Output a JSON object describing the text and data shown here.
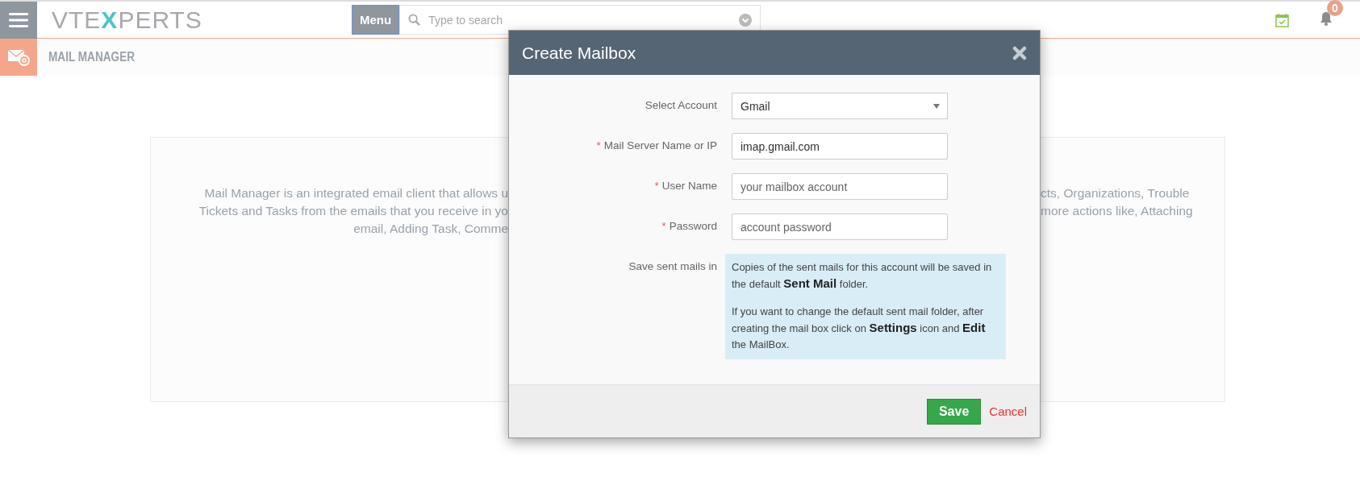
{
  "header": {
    "logo": {
      "before": "VTE",
      "accent": "X",
      "after": "PERTS"
    },
    "menu_button": "Menu",
    "search": {
      "placeholder": "Type to search"
    },
    "notifications": {
      "badge": "0"
    }
  },
  "subheader": {
    "title": "MAIL MANAGER"
  },
  "intro": {
    "lines": [
      {
        "left": "Mail Manager is an integrated email client that allows u",
        "right": "cts, Organizations, Trouble"
      },
      {
        "left": "Tickets and Tasks from the emails that you receive in yo",
        "right": "more actions like, Attaching"
      },
      {
        "left": "email, Adding Task, Comme"
      }
    ]
  },
  "dialog": {
    "title": "Create Mailbox",
    "fields": [
      {
        "kind": "select",
        "label": "Select Account",
        "value": "Gmail"
      },
      {
        "kind": "input",
        "required_mark": "*",
        "label": "Mail Server Name or IP",
        "value": "imap.gmail.com"
      },
      {
        "kind": "input",
        "required_mark": "*",
        "label": "User Name",
        "placeholder": "your mailbox account"
      },
      {
        "kind": "input",
        "required_mark": "*",
        "label": "Password",
        "placeholder": "account password"
      }
    ],
    "sent_mails": {
      "label": "Save sent mails in",
      "paragraphs": [
        "Copies of the sent mails for this account will be saved in the default **Sent Mail** folder.",
        "If you want to change the default sent mail folder, after creating the mail box click on **Settings** icon and **Edit** the MailBox."
      ]
    },
    "save": "Save",
    "cancel": "Cancel"
  }
}
